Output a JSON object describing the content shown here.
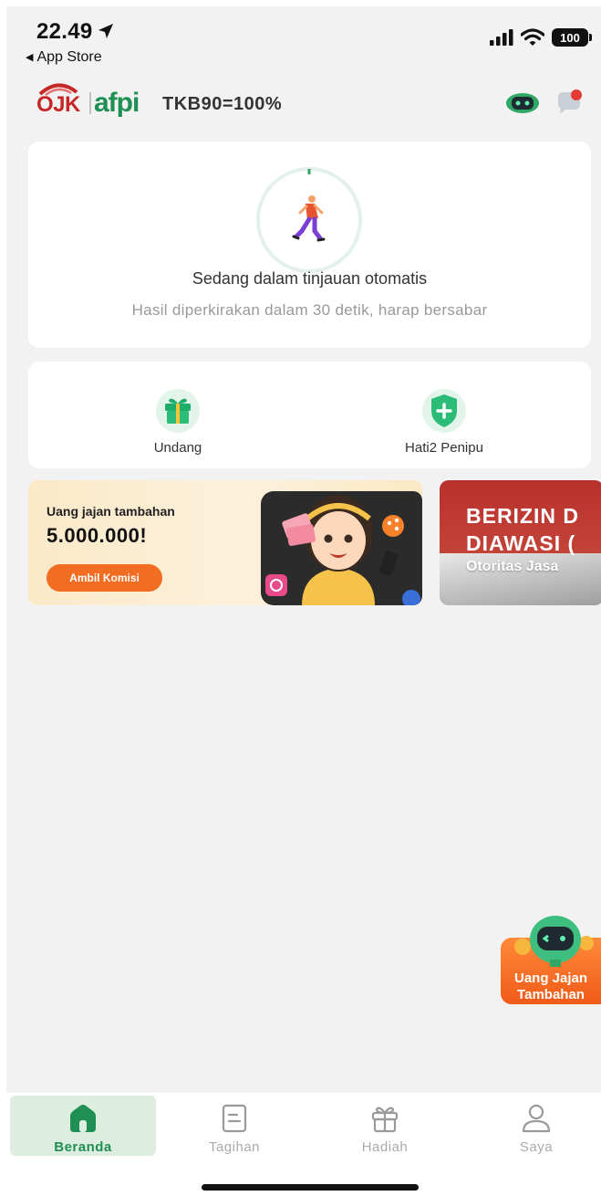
{
  "status_bar": {
    "time": "22.49",
    "back_app": "App Store",
    "battery": "100"
  },
  "header": {
    "ojk_logo_text": "OJK",
    "afpi_logo_text": "afpi",
    "tkb_text": "TKB90=100%"
  },
  "review": {
    "title": "Sedang dalam tinjauan otomatis",
    "subtitle": "Hasil diperkirakan dalam 30 detik, harap bersabar"
  },
  "shortcuts": [
    {
      "label": "Undang",
      "icon": "gift-icon"
    },
    {
      "label": "Hati2 Penipu",
      "icon": "shield-plus-icon"
    }
  ],
  "banners": {
    "promo": {
      "line1": "Uang jajan tambahan",
      "line2": "5.000.000!",
      "cta": "Ambil Komisi"
    },
    "regulated": {
      "line1": "BERIZIN D",
      "line2": "DIAWASI (",
      "line3": "Otoritas Jasa"
    }
  },
  "floating_promo": {
    "label": "Uang Jajan Tambahan"
  },
  "bottom_nav": [
    {
      "label": "Beranda",
      "icon": "home-icon",
      "active": true
    },
    {
      "label": "Tagihan",
      "icon": "bill-icon",
      "active": false
    },
    {
      "label": "Hadiah",
      "icon": "gift-box-icon",
      "active": false
    },
    {
      "label": "Saya",
      "icon": "user-icon",
      "active": false
    }
  ],
  "colors": {
    "brand_green": "#1f8f53",
    "accent_orange": "#f26d21",
    "ojk_red": "#c62828",
    "background": "#f2f2f2"
  }
}
